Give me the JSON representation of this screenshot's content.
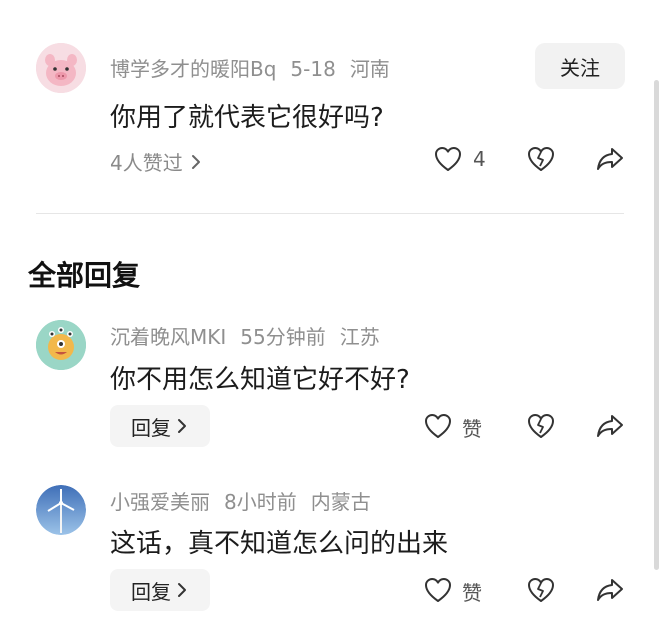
{
  "post": {
    "username": "博学多才的暖阳Bq",
    "date": "5-18",
    "location": "河南",
    "follow_label": "关注",
    "text": "你用了就代表它很好吗?",
    "likers_label": "4人赞过",
    "like_count": "4"
  },
  "replies_section": {
    "title": "全部回复"
  },
  "replies": [
    {
      "username": "沉着晚风MKI",
      "time": "55分钟前",
      "location": "江苏",
      "text": "你不用怎么知道它好不好?",
      "reply_label": "回复",
      "like_label": "赞"
    },
    {
      "username": "小强爱美丽",
      "time": "8小时前",
      "location": "内蒙古",
      "text": "这话，真不知道怎么问的出来",
      "reply_label": "回复",
      "like_label": "赞"
    }
  ],
  "icons": {
    "like": "heart-icon",
    "dislike": "broken-heart-icon",
    "share": "share-arrow-icon",
    "chevron": "chevron-right-icon"
  }
}
